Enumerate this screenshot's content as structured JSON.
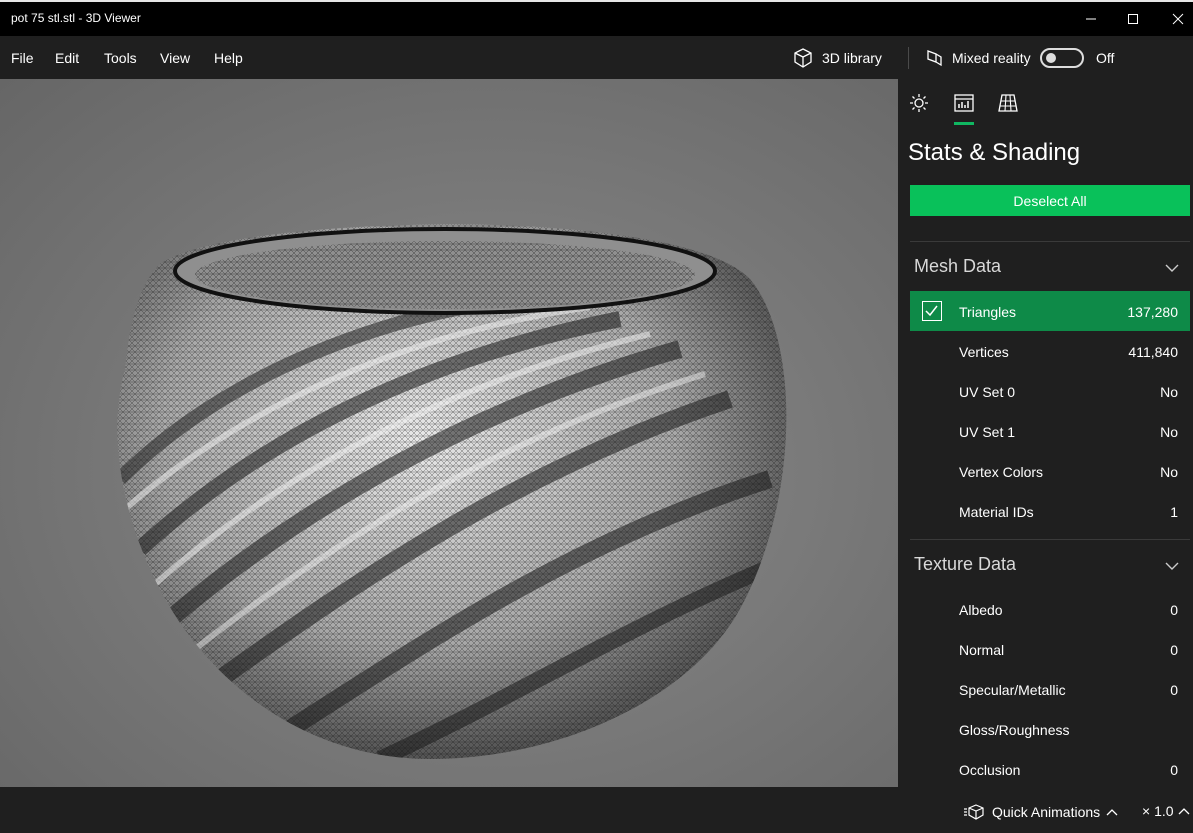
{
  "window": {
    "title": "pot 75 stl.stl - 3D Viewer"
  },
  "menu": {
    "items": [
      "File",
      "Edit",
      "Tools",
      "View",
      "Help"
    ]
  },
  "toolbar": {
    "library_label": "3D library",
    "mixed_reality_label": "Mixed reality",
    "toggle_state": "Off"
  },
  "panel": {
    "title": "Stats & Shading",
    "deselect_label": "Deselect All",
    "mesh": {
      "header": "Mesh Data",
      "rows": [
        {
          "label": "Triangles",
          "value": "137,280",
          "selected": true
        },
        {
          "label": "Vertices",
          "value": "411,840"
        },
        {
          "label": "UV Set 0",
          "value": "No"
        },
        {
          "label": "UV Set 1",
          "value": "No"
        },
        {
          "label": "Vertex Colors",
          "value": "No"
        },
        {
          "label": "Material IDs",
          "value": "1"
        }
      ]
    },
    "texture": {
      "header": "Texture Data",
      "rows": [
        {
          "label": "Albedo",
          "value": "0"
        },
        {
          "label": "Normal",
          "value": "0"
        },
        {
          "label": "Specular/Metallic",
          "value": "0"
        },
        {
          "label": "Gloss/Roughness",
          "value": ""
        },
        {
          "label": "Occlusion",
          "value": "0"
        }
      ]
    }
  },
  "status": {
    "animations_label": "Quick Animations",
    "speed": "× 1.0"
  },
  "colors": {
    "accent": "#09c15a",
    "selected_row": "#0e8a48"
  }
}
